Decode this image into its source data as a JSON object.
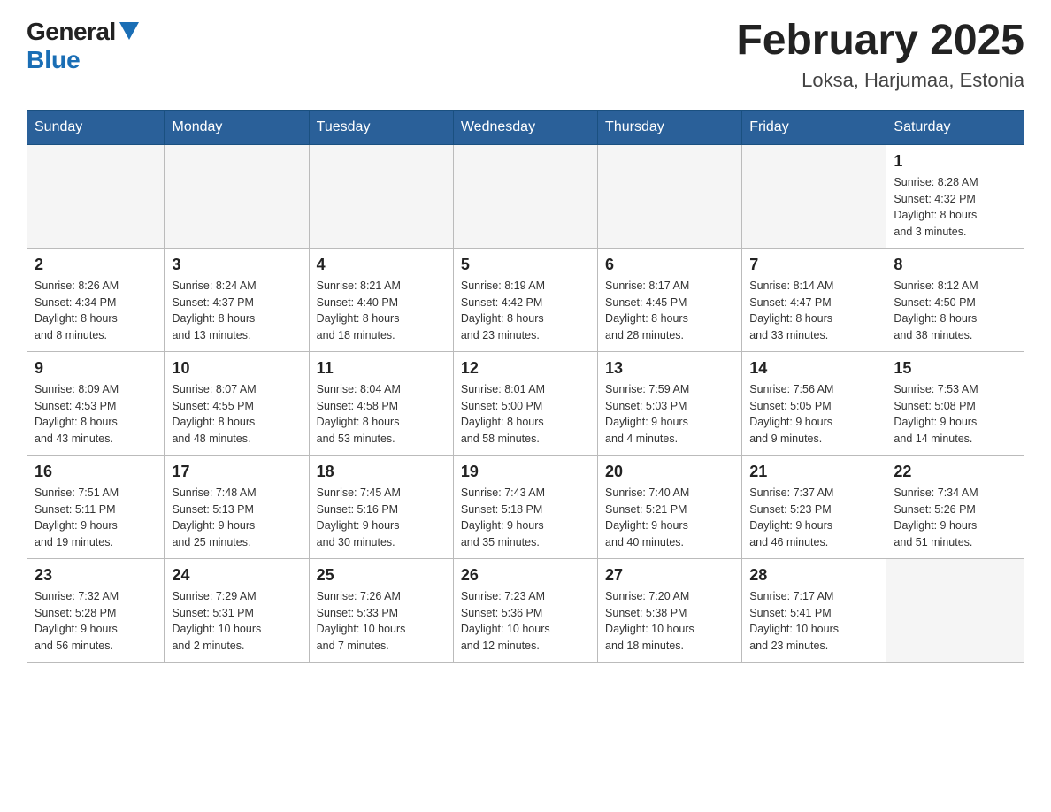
{
  "header": {
    "title": "February 2025",
    "location": "Loksa, Harjumaa, Estonia",
    "logo_general": "General",
    "logo_blue": "Blue"
  },
  "calendar": {
    "days_of_week": [
      "Sunday",
      "Monday",
      "Tuesday",
      "Wednesday",
      "Thursday",
      "Friday",
      "Saturday"
    ],
    "weeks": [
      [
        {
          "day": "",
          "info": ""
        },
        {
          "day": "",
          "info": ""
        },
        {
          "day": "",
          "info": ""
        },
        {
          "day": "",
          "info": ""
        },
        {
          "day": "",
          "info": ""
        },
        {
          "day": "",
          "info": ""
        },
        {
          "day": "1",
          "info": "Sunrise: 8:28 AM\nSunset: 4:32 PM\nDaylight: 8 hours\nand 3 minutes."
        }
      ],
      [
        {
          "day": "2",
          "info": "Sunrise: 8:26 AM\nSunset: 4:34 PM\nDaylight: 8 hours\nand 8 minutes."
        },
        {
          "day": "3",
          "info": "Sunrise: 8:24 AM\nSunset: 4:37 PM\nDaylight: 8 hours\nand 13 minutes."
        },
        {
          "day": "4",
          "info": "Sunrise: 8:21 AM\nSunset: 4:40 PM\nDaylight: 8 hours\nand 18 minutes."
        },
        {
          "day": "5",
          "info": "Sunrise: 8:19 AM\nSunset: 4:42 PM\nDaylight: 8 hours\nand 23 minutes."
        },
        {
          "day": "6",
          "info": "Sunrise: 8:17 AM\nSunset: 4:45 PM\nDaylight: 8 hours\nand 28 minutes."
        },
        {
          "day": "7",
          "info": "Sunrise: 8:14 AM\nSunset: 4:47 PM\nDaylight: 8 hours\nand 33 minutes."
        },
        {
          "day": "8",
          "info": "Sunrise: 8:12 AM\nSunset: 4:50 PM\nDaylight: 8 hours\nand 38 minutes."
        }
      ],
      [
        {
          "day": "9",
          "info": "Sunrise: 8:09 AM\nSunset: 4:53 PM\nDaylight: 8 hours\nand 43 minutes."
        },
        {
          "day": "10",
          "info": "Sunrise: 8:07 AM\nSunset: 4:55 PM\nDaylight: 8 hours\nand 48 minutes."
        },
        {
          "day": "11",
          "info": "Sunrise: 8:04 AM\nSunset: 4:58 PM\nDaylight: 8 hours\nand 53 minutes."
        },
        {
          "day": "12",
          "info": "Sunrise: 8:01 AM\nSunset: 5:00 PM\nDaylight: 8 hours\nand 58 minutes."
        },
        {
          "day": "13",
          "info": "Sunrise: 7:59 AM\nSunset: 5:03 PM\nDaylight: 9 hours\nand 4 minutes."
        },
        {
          "day": "14",
          "info": "Sunrise: 7:56 AM\nSunset: 5:05 PM\nDaylight: 9 hours\nand 9 minutes."
        },
        {
          "day": "15",
          "info": "Sunrise: 7:53 AM\nSunset: 5:08 PM\nDaylight: 9 hours\nand 14 minutes."
        }
      ],
      [
        {
          "day": "16",
          "info": "Sunrise: 7:51 AM\nSunset: 5:11 PM\nDaylight: 9 hours\nand 19 minutes."
        },
        {
          "day": "17",
          "info": "Sunrise: 7:48 AM\nSunset: 5:13 PM\nDaylight: 9 hours\nand 25 minutes."
        },
        {
          "day": "18",
          "info": "Sunrise: 7:45 AM\nSunset: 5:16 PM\nDaylight: 9 hours\nand 30 minutes."
        },
        {
          "day": "19",
          "info": "Sunrise: 7:43 AM\nSunset: 5:18 PM\nDaylight: 9 hours\nand 35 minutes."
        },
        {
          "day": "20",
          "info": "Sunrise: 7:40 AM\nSunset: 5:21 PM\nDaylight: 9 hours\nand 40 minutes."
        },
        {
          "day": "21",
          "info": "Sunrise: 7:37 AM\nSunset: 5:23 PM\nDaylight: 9 hours\nand 46 minutes."
        },
        {
          "day": "22",
          "info": "Sunrise: 7:34 AM\nSunset: 5:26 PM\nDaylight: 9 hours\nand 51 minutes."
        }
      ],
      [
        {
          "day": "23",
          "info": "Sunrise: 7:32 AM\nSunset: 5:28 PM\nDaylight: 9 hours\nand 56 minutes."
        },
        {
          "day": "24",
          "info": "Sunrise: 7:29 AM\nSunset: 5:31 PM\nDaylight: 10 hours\nand 2 minutes."
        },
        {
          "day": "25",
          "info": "Sunrise: 7:26 AM\nSunset: 5:33 PM\nDaylight: 10 hours\nand 7 minutes."
        },
        {
          "day": "26",
          "info": "Sunrise: 7:23 AM\nSunset: 5:36 PM\nDaylight: 10 hours\nand 12 minutes."
        },
        {
          "day": "27",
          "info": "Sunrise: 7:20 AM\nSunset: 5:38 PM\nDaylight: 10 hours\nand 18 minutes."
        },
        {
          "day": "28",
          "info": "Sunrise: 7:17 AM\nSunset: 5:41 PM\nDaylight: 10 hours\nand 23 minutes."
        },
        {
          "day": "",
          "info": ""
        }
      ]
    ]
  }
}
